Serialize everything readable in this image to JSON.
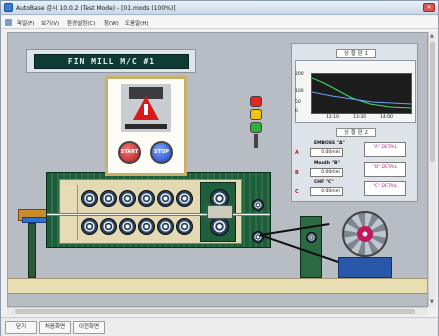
{
  "window": {
    "title": "AutoBase 감시 10.0.2 (Test Mode) - [01.mods (100%)]",
    "close_glyph": "✕"
  },
  "menu": {
    "items": [
      "파일(F)",
      "보기(V)",
      "환경설정(C)",
      "창(W)",
      "도움말(H)"
    ]
  },
  "hmi": {
    "banner": "FIN MILL M/C #1",
    "start_label": "START",
    "stop_label": "STOP"
  },
  "status_panel": {
    "title_1": "상 황 판 1",
    "title_2": "상 황 판 2",
    "trend": {
      "y_ticks": [
        "200",
        "100",
        "50",
        "0"
      ],
      "x_ticks": [
        "12:10",
        "13:30",
        "14:00"
      ]
    },
    "measures": [
      {
        "letter": "A",
        "name": "EMBOSS \"A\"",
        "value": "0.00mm",
        "detail": "\"A\" DETAIL"
      },
      {
        "letter": "B",
        "name": "Mouth \"B\"",
        "value": "0.00mm",
        "detail": "\"B\" DETAIL"
      },
      {
        "letter": "C",
        "name": "CHF \"C\"",
        "value": "0.00mm",
        "detail": "\"C\" DETAIL"
      }
    ]
  },
  "colors": {
    "lamp_red": "#e32420",
    "lamp_yellow": "#f2c40d",
    "lamp_green": "#2fae3a",
    "mill_green": "#1e5c3a"
  },
  "bottom_buttons": [
    "닫기",
    "처음화면",
    "이전화면"
  ]
}
